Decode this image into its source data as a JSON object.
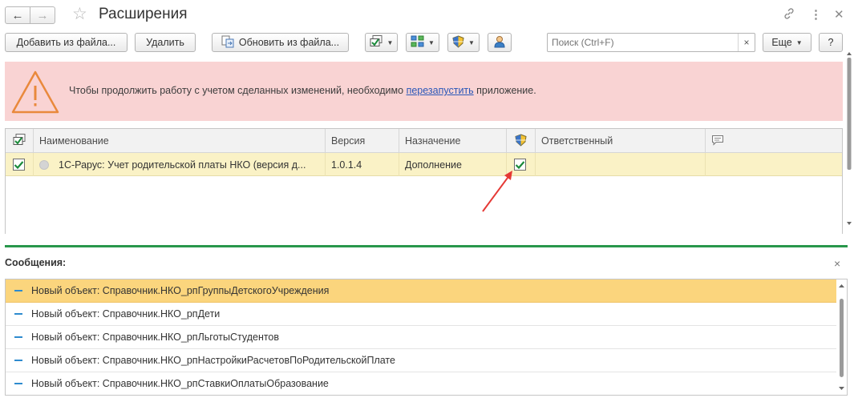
{
  "window": {
    "title": "Расширения"
  },
  "toolbar": {
    "add_from_file": "Добавить из файла...",
    "delete": "Удалить",
    "update_from_file": "Обновить из файла...",
    "search_placeholder": "Поиск (Ctrl+F)",
    "more": "Еще",
    "help": "?"
  },
  "banner": {
    "text_before": "Чтобы продолжить работу с учетом сделанных изменений, необходимо ",
    "link": "перезапустить",
    "text_after": " приложение."
  },
  "grid": {
    "columns": {
      "name": "Наименование",
      "version": "Версия",
      "purpose": "Назначение",
      "responsible": "Ответственный"
    },
    "rows": [
      {
        "active": true,
        "name": "1С-Рарус: Учет родительской платы НКО (версия д...",
        "version": "1.0.1.4",
        "purpose": "Дополнение",
        "safe_mode": true,
        "responsible": ""
      }
    ]
  },
  "messages": {
    "title": "Сообщения:",
    "items": [
      "Новый объект: Справочник.НКО_рпГруппыДетскогоУчреждения",
      "Новый объект: Справочник.НКО_рпДети",
      "Новый объект: Справочник.НКО_рпЛьготыСтудентов",
      "Новый объект: Справочник.НКО_рпНастройкиРасчетовПоРодительскойПлате",
      "Новый объект: Справочник.НКО_рпСтавкиОплатыОбразование"
    ],
    "selected_index": 0
  },
  "colors": {
    "banner_bg": "#f9d3d3",
    "selected_row": "#faf2c6",
    "selected_message": "#fbd57d",
    "divider": "#28974b",
    "link": "#2a57b8",
    "arrow": "#e53935"
  },
  "icons": [
    "back-arrow-icon",
    "forward-arrow-icon",
    "favorite-star-icon",
    "link-icon",
    "more-vertical-icon",
    "close-icon",
    "update-file-icon",
    "check-list-icon",
    "structure-icon",
    "shield-icon",
    "user-icon",
    "warning-triangle-icon",
    "comment-icon"
  ]
}
